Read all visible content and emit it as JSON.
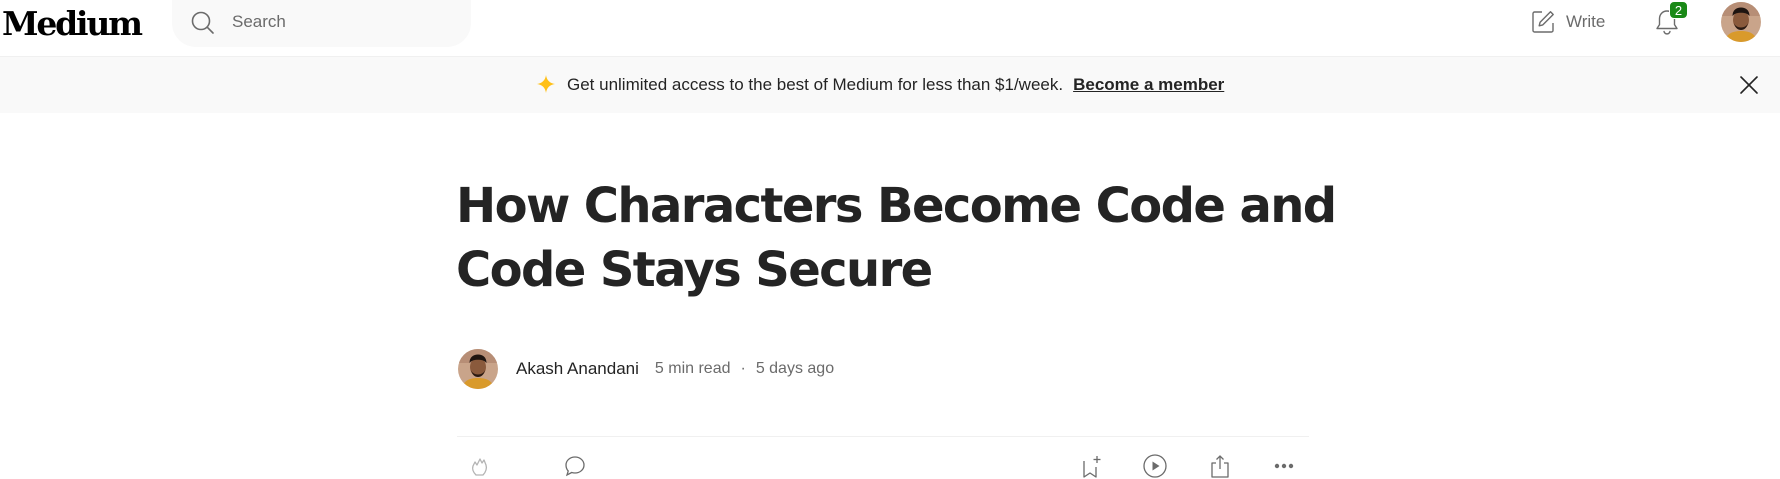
{
  "nav": {
    "logo": "Medium",
    "search_placeholder": "Search",
    "write_label": "Write",
    "notification_count": "2"
  },
  "banner": {
    "message": "Get unlimited access to the best of Medium for less than $1/week.",
    "cta": "Become a member",
    "accent_color": "#ffc017"
  },
  "article": {
    "title": "How Characters Become Code and Code Stays Secure",
    "author": "Akash Anandani",
    "read_time": "5 min read",
    "separator": "·",
    "published": "5 days ago"
  },
  "icons": {
    "clap": "clap-icon",
    "comment": "comment-icon",
    "save": "bookmark-add-icon",
    "listen": "play-icon",
    "share": "share-icon",
    "more": "more-icon"
  },
  "colors": {
    "text": "#242424",
    "muted": "#6b6b6b",
    "badge": "#1a8917",
    "banner_bg": "#f9f9f9"
  }
}
